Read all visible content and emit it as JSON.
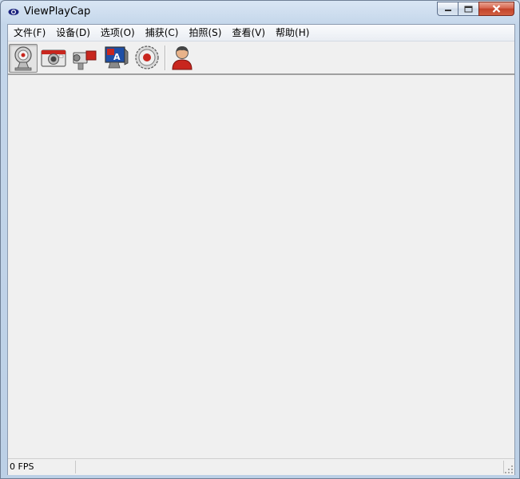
{
  "window": {
    "title": "ViewPlayCap"
  },
  "caption": {
    "minimize_icon": "minimize-icon",
    "maximize_icon": "maximize-icon",
    "close_icon": "close-icon"
  },
  "menu": [
    {
      "label": "文件(F)"
    },
    {
      "label": "设备(D)"
    },
    {
      "label": "选项(O)"
    },
    {
      "label": "捕获(C)"
    },
    {
      "label": "拍照(S)"
    },
    {
      "label": "查看(V)"
    },
    {
      "label": "帮助(H)"
    }
  ],
  "toolbar": {
    "buttons": [
      {
        "icon": "webcam-icon",
        "pressed": true
      },
      {
        "icon": "camera-icon",
        "pressed": false
      },
      {
        "icon": "camcorder-icon",
        "pressed": false
      },
      {
        "icon": "display-settings-icon",
        "pressed": false
      },
      {
        "icon": "record-icon",
        "pressed": false
      },
      {
        "icon": "user-icon",
        "pressed": false
      }
    ]
  },
  "statusbar": {
    "fps": "0 FPS"
  },
  "colors": {
    "accent_red": "#c8261e",
    "close_red": "#c2432a"
  }
}
